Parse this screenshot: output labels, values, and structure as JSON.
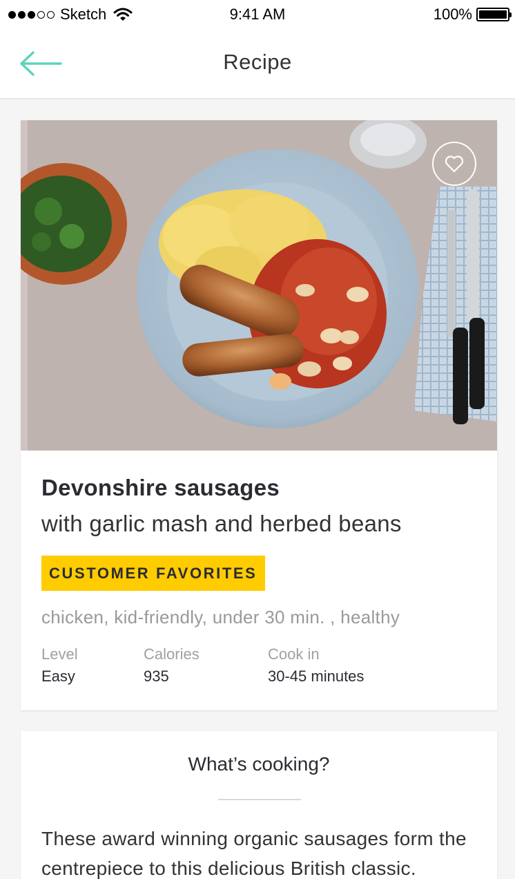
{
  "status_bar": {
    "carrier": "Sketch",
    "time": "9:41 AM",
    "battery_percent": "100%",
    "battery_level": 1.0,
    "signal_filled": 3,
    "signal_total": 5
  },
  "nav": {
    "title": "Recipe",
    "back_icon": "arrow-left-icon",
    "accent_color": "#5fd3bc"
  },
  "recipe": {
    "favorite_icon": "heart-outline-icon",
    "title": "Devonshire sausages",
    "subtitle": "with garlic mash and herbed beans",
    "badge": "CUSTOMER FAVORITES",
    "badge_color": "#ffcc00",
    "tags": "chicken, kid-friendly, under 30 min. , healthy",
    "stats": [
      {
        "label": "Level",
        "value": "Easy"
      },
      {
        "label": "Calories",
        "value": "935"
      },
      {
        "label": "Cook in",
        "value": "30-45 minutes"
      }
    ]
  },
  "cooking": {
    "title": "What’s cooking?",
    "text": "These award winning organic sausages form the centrepiece to this delicious British classic."
  }
}
